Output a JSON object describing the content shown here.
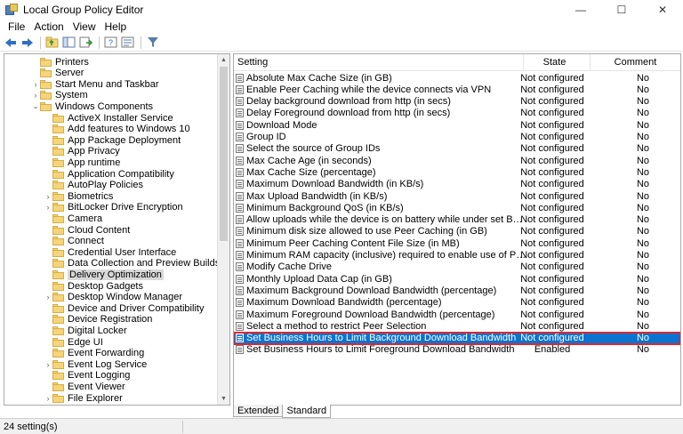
{
  "window": {
    "title": "Local Group Policy Editor",
    "minimize": "—",
    "maximize": "☐",
    "close": "✕"
  },
  "menu": [
    "File",
    "Action",
    "View",
    "Help"
  ],
  "toolbar": [
    {
      "icon": "back-arrow-icon"
    },
    {
      "icon": "forward-arrow-icon"
    },
    {
      "icon": "up-folder-icon"
    },
    {
      "icon": "show-hide-tree-icon"
    },
    {
      "icon": "export-list-icon"
    },
    {
      "icon": "help-icon"
    },
    {
      "icon": "properties-icon"
    },
    {
      "icon": "filter-icon"
    }
  ],
  "tree": [
    {
      "label": "Printers",
      "level": 1,
      "expand": ""
    },
    {
      "label": "Server",
      "level": 1,
      "expand": ""
    },
    {
      "label": "Start Menu and Taskbar",
      "level": 1,
      "expand": "›"
    },
    {
      "label": "System",
      "level": 1,
      "expand": "›"
    },
    {
      "label": "Windows Components",
      "level": 1,
      "expand": "⌄"
    },
    {
      "label": "ActiveX Installer Service",
      "level": 2,
      "expand": ""
    },
    {
      "label": "Add features to Windows 10",
      "level": 2,
      "expand": ""
    },
    {
      "label": "App Package Deployment",
      "level": 2,
      "expand": ""
    },
    {
      "label": "App Privacy",
      "level": 2,
      "expand": ""
    },
    {
      "label": "App runtime",
      "level": 2,
      "expand": ""
    },
    {
      "label": "Application Compatibility",
      "level": 2,
      "expand": ""
    },
    {
      "label": "AutoPlay Policies",
      "level": 2,
      "expand": ""
    },
    {
      "label": "Biometrics",
      "level": 2,
      "expand": "›"
    },
    {
      "label": "BitLocker Drive Encryption",
      "level": 2,
      "expand": "›"
    },
    {
      "label": "Camera",
      "level": 2,
      "expand": ""
    },
    {
      "label": "Cloud Content",
      "level": 2,
      "expand": ""
    },
    {
      "label": "Connect",
      "level": 2,
      "expand": ""
    },
    {
      "label": "Credential User Interface",
      "level": 2,
      "expand": ""
    },
    {
      "label": "Data Collection and Preview Builds",
      "level": 2,
      "expand": ""
    },
    {
      "label": "Delivery Optimization",
      "level": 2,
      "expand": "",
      "selected": true
    },
    {
      "label": "Desktop Gadgets",
      "level": 2,
      "expand": ""
    },
    {
      "label": "Desktop Window Manager",
      "level": 2,
      "expand": "›"
    },
    {
      "label": "Device and Driver Compatibility",
      "level": 2,
      "expand": ""
    },
    {
      "label": "Device Registration",
      "level": 2,
      "expand": ""
    },
    {
      "label": "Digital Locker",
      "level": 2,
      "expand": ""
    },
    {
      "label": "Edge UI",
      "level": 2,
      "expand": ""
    },
    {
      "label": "Event Forwarding",
      "level": 2,
      "expand": ""
    },
    {
      "label": "Event Log Service",
      "level": 2,
      "expand": "›"
    },
    {
      "label": "Event Logging",
      "level": 2,
      "expand": ""
    },
    {
      "label": "Event Viewer",
      "level": 2,
      "expand": ""
    },
    {
      "label": "File Explorer",
      "level": 2,
      "expand": "›"
    }
  ],
  "list": {
    "headers": {
      "setting": "Setting",
      "state": "State",
      "comment": "Comment"
    },
    "rows": [
      {
        "setting": "Absolute Max Cache Size (in GB)",
        "state": "Not configured",
        "comment": "No"
      },
      {
        "setting": "Enable Peer Caching while the device connects via VPN",
        "state": "Not configured",
        "comment": "No"
      },
      {
        "setting": "Delay background download from http (in secs)",
        "state": "Not configured",
        "comment": "No"
      },
      {
        "setting": "Delay Foreground download from http (in secs)",
        "state": "Not configured",
        "comment": "No"
      },
      {
        "setting": "Download Mode",
        "state": "Not configured",
        "comment": "No"
      },
      {
        "setting": "Group ID",
        "state": "Not configured",
        "comment": "No"
      },
      {
        "setting": "Select the source of Group IDs",
        "state": "Not configured",
        "comment": "No"
      },
      {
        "setting": "Max Cache Age (in seconds)",
        "state": "Not configured",
        "comment": "No"
      },
      {
        "setting": "Max Cache Size (percentage)",
        "state": "Not configured",
        "comment": "No"
      },
      {
        "setting": "Maximum Download Bandwidth (in KB/s)",
        "state": "Not configured",
        "comment": "No"
      },
      {
        "setting": "Max Upload Bandwidth (in KB/s)",
        "state": "Not configured",
        "comment": "No"
      },
      {
        "setting": "Minimum Background QoS (in KB/s)",
        "state": "Not configured",
        "comment": "No"
      },
      {
        "setting": "Allow uploads while the device is on battery while under set Battery level (percent...",
        "state": "Not configured",
        "comment": "No"
      },
      {
        "setting": "Minimum disk size allowed to use Peer Caching (in GB)",
        "state": "Not configured",
        "comment": "No"
      },
      {
        "setting": "Minimum Peer Caching Content File Size (in MB)",
        "state": "Not configured",
        "comment": "No"
      },
      {
        "setting": "Minimum RAM capacity (inclusive) required to enable use of Peer Caching (in GB)",
        "state": "Not configured",
        "comment": "No"
      },
      {
        "setting": "Modify Cache Drive",
        "state": "Not configured",
        "comment": "No"
      },
      {
        "setting": "Monthly Upload Data Cap (in GB)",
        "state": "Not configured",
        "comment": "No"
      },
      {
        "setting": "Maximum Background Download Bandwidth (percentage)",
        "state": "Not configured",
        "comment": "No"
      },
      {
        "setting": "Maximum Download Bandwidth (percentage)",
        "state": "Not configured",
        "comment": "No"
      },
      {
        "setting": "Maximum Foreground Download Bandwidth (percentage)",
        "state": "Not configured",
        "comment": "No"
      },
      {
        "setting": "Select a method to restrict Peer Selection",
        "state": "Not configured",
        "comment": "No"
      },
      {
        "setting": "Set Business Hours to Limit Background Download Bandwidth",
        "state": "Not configured",
        "comment": "No",
        "selected": true
      },
      {
        "setting": "Set Business Hours to Limit Foreground Download Bandwidth",
        "state": "Enabled",
        "comment": "No"
      }
    ]
  },
  "tabs": [
    "Extended",
    "Standard"
  ],
  "status": "24 setting(s)",
  "colors": {
    "selection": "#0a74d0",
    "highlight_outline": "#e0262e"
  }
}
